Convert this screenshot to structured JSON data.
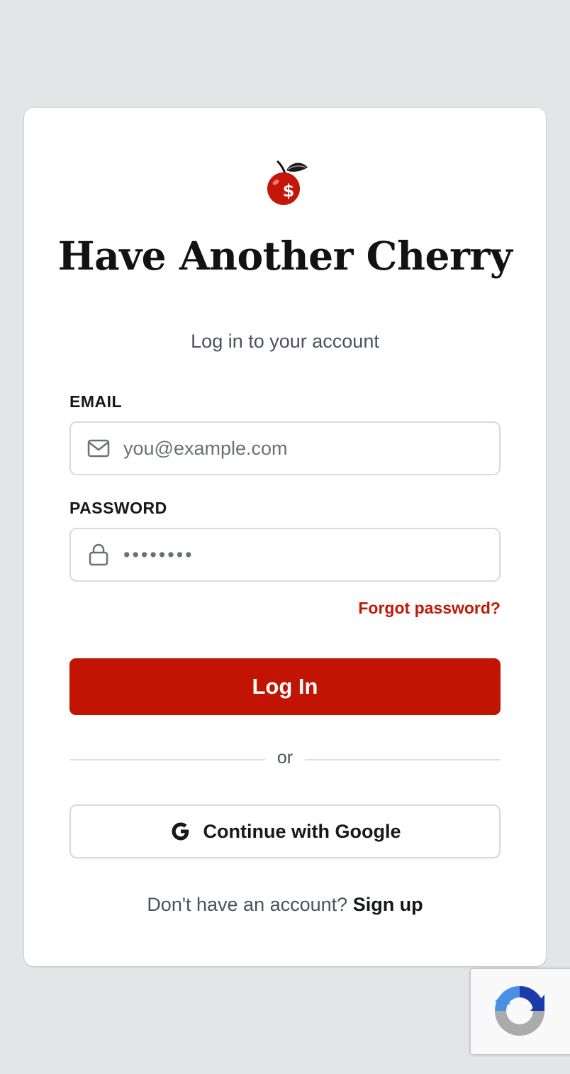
{
  "brand": {
    "title": "Have Another Cherry",
    "logo_icon": "cherry-dollar-icon",
    "accent_color": "#c11402"
  },
  "login": {
    "subtitle": "Log in to your account",
    "email_label": "EMAIL",
    "email_placeholder": "you@example.com",
    "email_icon": "mail-icon",
    "password_label": "PASSWORD",
    "password_value": "••••••••",
    "password_icon": "lock-icon",
    "forgot_link": "Forgot password?",
    "submit_label": "Log In",
    "divider_text": "or",
    "google_label": "Continue with Google",
    "google_icon": "google-icon",
    "signup_prompt": "Don't have an account?",
    "signup_link": "Sign up"
  },
  "recaptcha": {
    "icon": "recaptcha-icon"
  }
}
